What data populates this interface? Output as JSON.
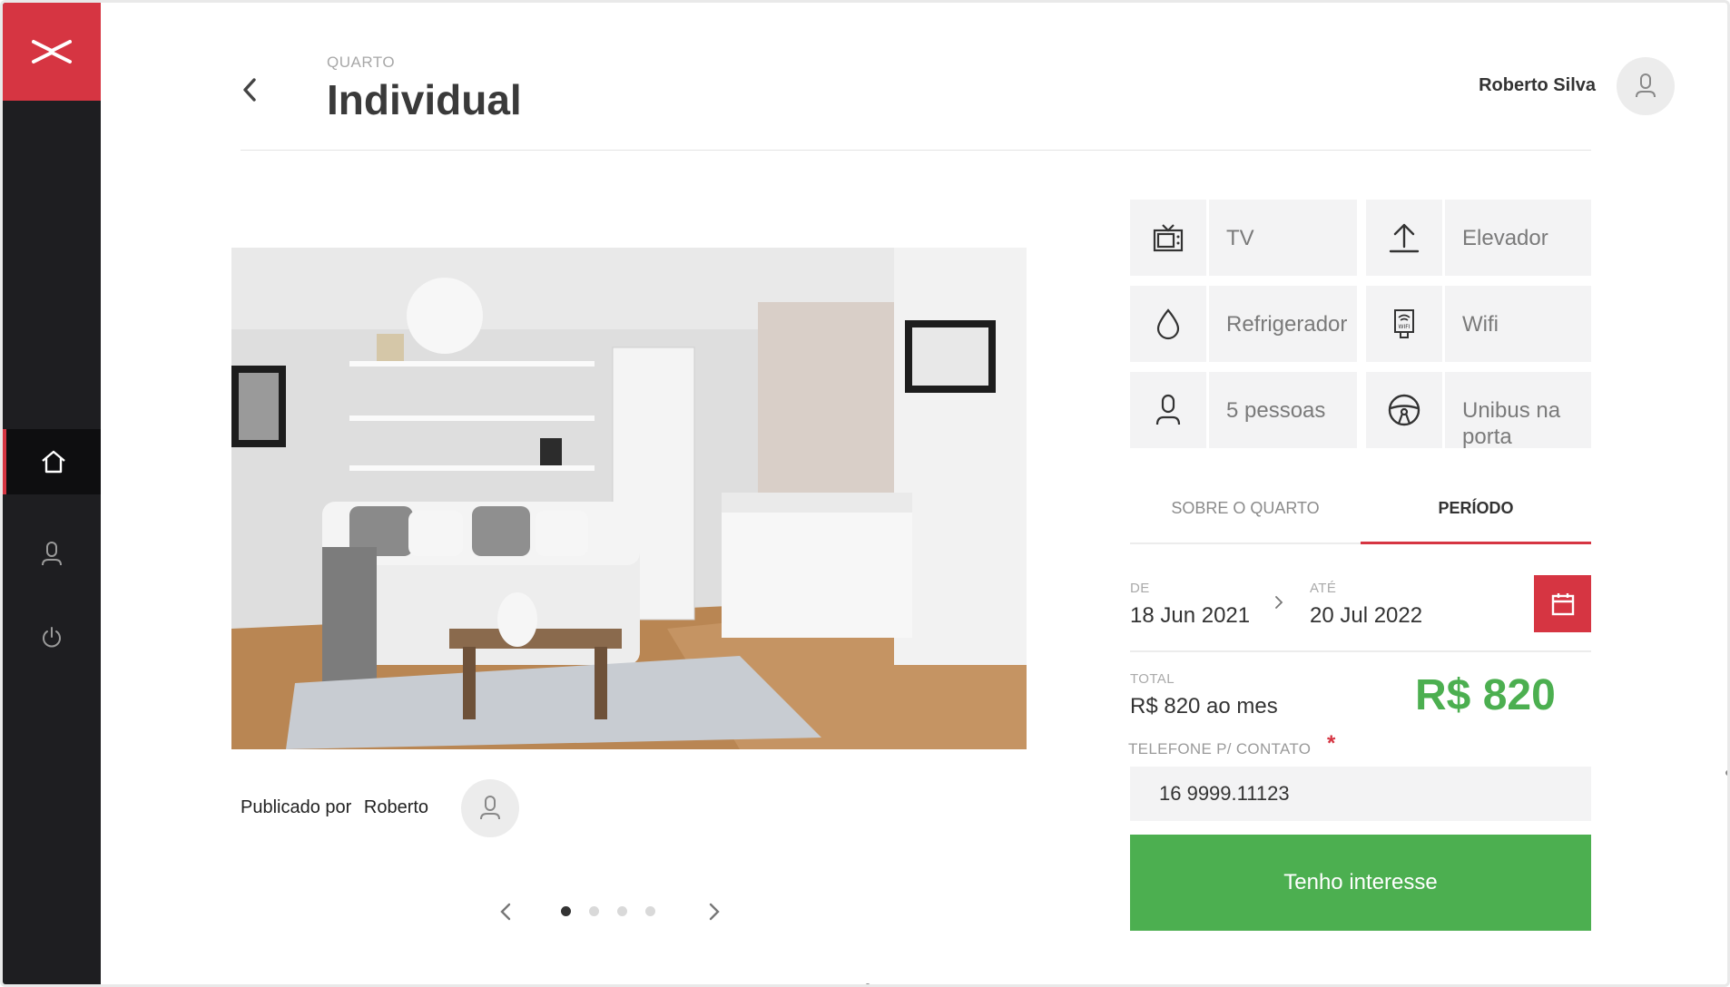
{
  "sidebar": {
    "logo_icon": "scissors-logo-icon",
    "items": [
      {
        "icon": "home-icon",
        "active": true
      },
      {
        "icon": "user-icon",
        "active": false
      },
      {
        "icon": "power-icon",
        "active": false
      }
    ]
  },
  "header": {
    "subtitle": "QUARTO",
    "title": "Individual",
    "back_icon": "chevron-left-icon",
    "user_name": "Roberto Silva"
  },
  "listing": {
    "published_label": "Publicado por",
    "author": "Roberto",
    "carousel": {
      "total": 4,
      "active_index": 0
    }
  },
  "amenities": [
    {
      "icon": "tv-icon",
      "label": "TV"
    },
    {
      "icon": "arrow-up-icon",
      "label": "Elevador"
    },
    {
      "icon": "droplet-icon",
      "label": "Refrigerador"
    },
    {
      "icon": "wifi-icon",
      "label": "Wifi"
    },
    {
      "icon": "user-icon",
      "label": "5 pessoas"
    },
    {
      "icon": "steering-wheel-icon",
      "label": "Unibus na porta"
    }
  ],
  "tabs": [
    {
      "label": "SOBRE O QUARTO",
      "active": false
    },
    {
      "label": "PERÍODO",
      "active": true
    }
  ],
  "period": {
    "from_label": "DE",
    "from_value": "18 Jun 2021",
    "to_label": "ATÉ",
    "to_value": "20 Jul 2022"
  },
  "total": {
    "label": "TOTAL",
    "value": "R$ 820 ao mes",
    "price": "R$ 820"
  },
  "contact": {
    "label": "TELEFONE P/ CONTATO",
    "required_mark": "*",
    "value": "16 9999.11123"
  },
  "cta_label": "Tenho interesse",
  "colors": {
    "brand_red": "#d63542",
    "sidebar_dark": "#1e1e21",
    "success_green": "#4caf50"
  }
}
